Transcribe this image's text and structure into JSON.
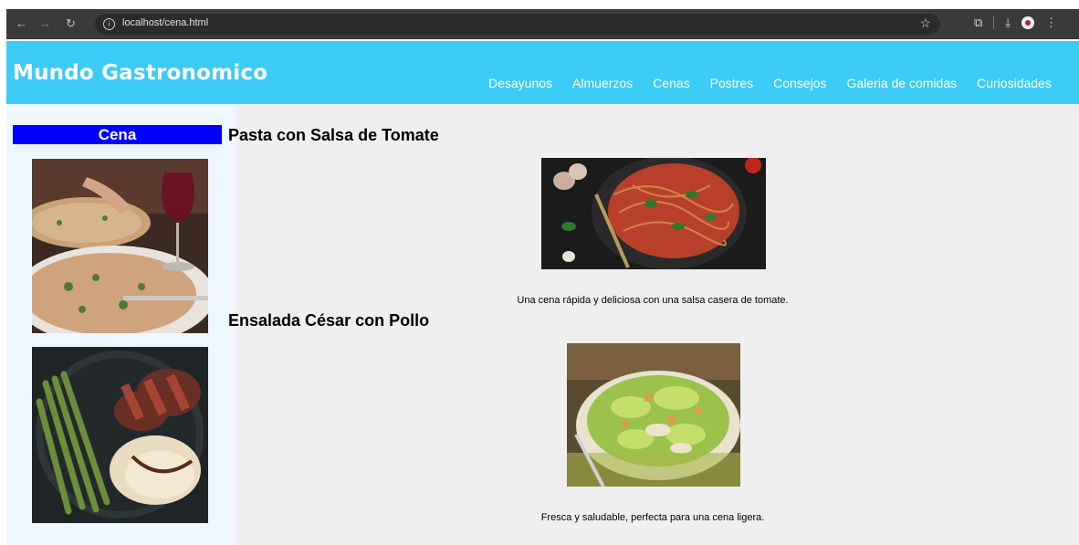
{
  "browser": {
    "url": "localhost/cena.html"
  },
  "header": {
    "brand": "Mundo Gastronomico",
    "nav": [
      "Desayunos",
      "Almuerzos",
      "Cenas",
      "Postres",
      "Consejos",
      "Galeria de comidas",
      "Curiosidades"
    ]
  },
  "sidebar": {
    "title": "Cena"
  },
  "dishes": [
    {
      "title": "Pasta con Salsa de Tomate",
      "description": "Una cena rápida y deliciosa con una salsa casera de tomate."
    },
    {
      "title": "Ensalada César con Pollo",
      "description": "Fresca y saludable, perfecta para una cena ligera."
    }
  ]
}
